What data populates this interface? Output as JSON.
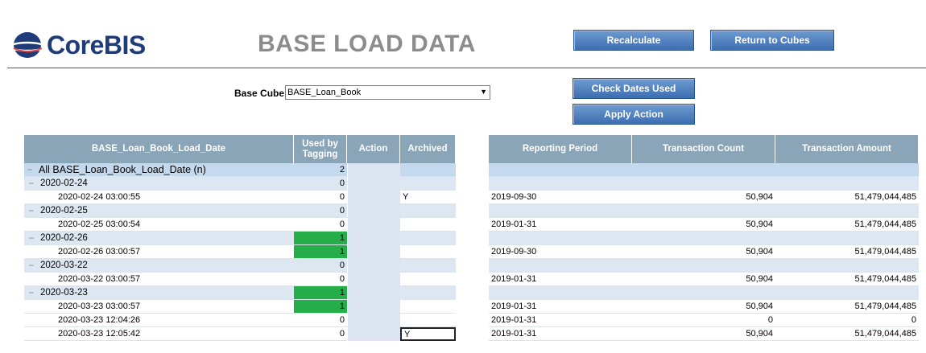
{
  "brand": {
    "name": "CoreBIS"
  },
  "page": {
    "title": "BASE LOAD DATA"
  },
  "buttons": {
    "recalculate": "Recalculate",
    "return_to_cubes": "Return to Cubes",
    "check_dates_used": "Check Dates Used",
    "apply_action": "Apply Action"
  },
  "base_cube": {
    "label": "Base Cube",
    "value": "BASE_Loan_Book"
  },
  "left_table": {
    "headers": [
      "BASE_Loan_Book_Load_Date",
      "Used by Tagging",
      "Action",
      "Archived"
    ]
  },
  "right_table": {
    "headers": [
      "Reporting Period",
      "Transaction Count",
      "Transaction Amount"
    ]
  },
  "rows": [
    {
      "kind": "total",
      "date": "All BASE_Loan_Book_Load_Date (n)",
      "used": "2",
      "archived": "",
      "period": "",
      "count": "",
      "amount": ""
    },
    {
      "kind": "group",
      "date": "2020-02-24",
      "used": "0",
      "archived": "",
      "period": "",
      "count": "",
      "amount": ""
    },
    {
      "kind": "leaf",
      "date": "2020-02-24 03:00:55",
      "used": "0",
      "archived": "Y",
      "period": "2019-09-30",
      "count": "50,904",
      "amount": "51,479,044,485"
    },
    {
      "kind": "group",
      "date": "2020-02-25",
      "used": "0",
      "archived": "",
      "period": "",
      "count": "",
      "amount": ""
    },
    {
      "kind": "leaf",
      "date": "2020-02-25 03:00:54",
      "used": "0",
      "archived": "",
      "period": "2019-01-31",
      "count": "50,904",
      "amount": "51,479,044,485"
    },
    {
      "kind": "group",
      "date": "2020-02-26",
      "used": "1",
      "green": true,
      "archived": "",
      "period": "",
      "count": "",
      "amount": ""
    },
    {
      "kind": "leaf",
      "date": "2020-02-26 03:00:57",
      "used": "1",
      "green": true,
      "archived": "",
      "period": "2019-09-30",
      "count": "50,904",
      "amount": "51,479,044,485"
    },
    {
      "kind": "group",
      "date": "2020-03-22",
      "used": "0",
      "archived": "",
      "period": "",
      "count": "",
      "amount": ""
    },
    {
      "kind": "leaf",
      "date": "2020-03-22 03:00:57",
      "used": "0",
      "archived": "",
      "period": "2019-01-31",
      "count": "50,904",
      "amount": "51,479,044,485"
    },
    {
      "kind": "group",
      "date": "2020-03-23",
      "used": "1",
      "green": true,
      "archived": "",
      "period": "",
      "count": "",
      "amount": ""
    },
    {
      "kind": "leaf",
      "date": "2020-03-23 03:00:57",
      "used": "1",
      "green": true,
      "archived": "",
      "period": "2019-01-31",
      "count": "50,904",
      "amount": "51,479,044,485"
    },
    {
      "kind": "leaf",
      "date": "2020-03-23 12:04:26",
      "used": "0",
      "archived": "",
      "period": "2019-01-31",
      "count": "0",
      "amount": "0"
    },
    {
      "kind": "leaf",
      "date": "2020-03-23 12:05:42",
      "used": "0",
      "archived": "Y",
      "selected": true,
      "period": "2019-01-31",
      "count": "50,904",
      "amount": "51,479,044,485"
    }
  ],
  "colors": {
    "header_bg": "#8aa4b8",
    "group_bg": "#dde7f2",
    "total_bg": "#c5d9ee",
    "tag_green": "#24ad48",
    "button_blue": "#3c6eb0",
    "title_gray": "#8c8c8c"
  },
  "icons": {
    "logo": "corebis-globe-icon",
    "dropdown": "dropdown-arrow-icon",
    "collapse": "minus-collapse-icon"
  }
}
